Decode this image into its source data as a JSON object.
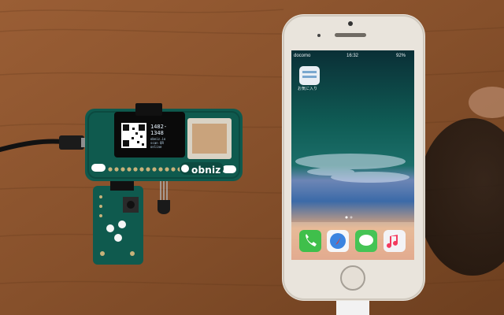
{
  "scene": {
    "description_objects": [
      "obniz-board",
      "sensor-board",
      "smartphone",
      "usb-cable",
      "lightning-cable",
      "hand"
    ],
    "colors": {
      "table": "#8a5430",
      "table_dark": "#5e3516",
      "pcb": "#0f5a4e",
      "phone_frame": "#e9e4dc",
      "screen_dark": "#0d3b38",
      "accent_white": "#ffffff"
    }
  },
  "obniz": {
    "brand": "obniz",
    "oled_id": "1482-1348",
    "oled_small": "obniz.io\nscan QR\nonline"
  },
  "phone": {
    "status_carrier": "docomo",
    "status_time": "16:32",
    "status_battery": "92%",
    "home_app_label": "お気に入り",
    "dock_icons": [
      "phone-icon",
      "safari-icon",
      "messages-icon",
      "music-icon"
    ]
  }
}
